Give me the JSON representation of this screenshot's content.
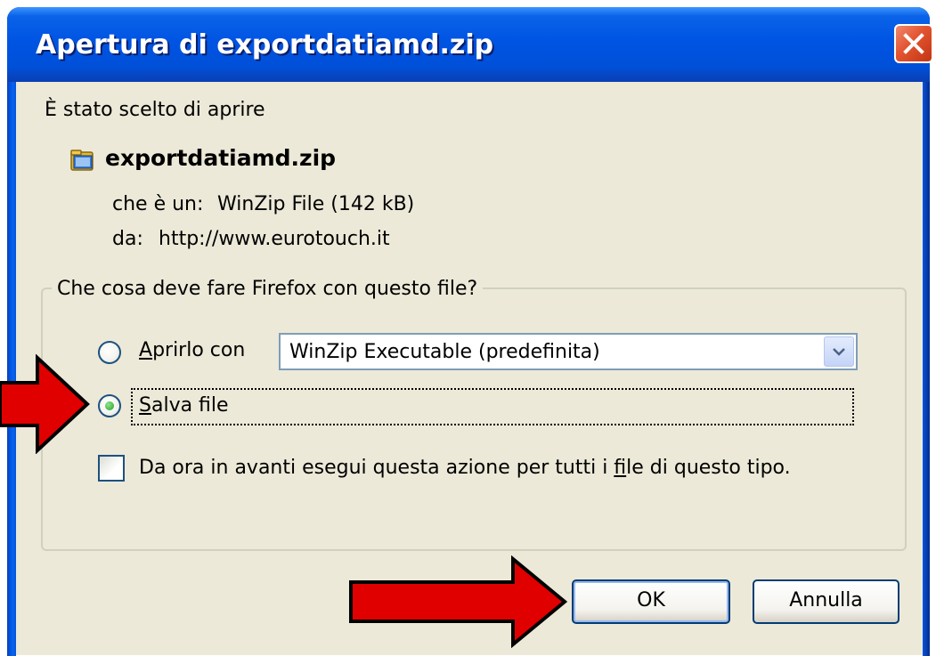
{
  "window": {
    "title": "Apertura di exportdatiamd.zip"
  },
  "intro": {
    "text": "È stato scelto di aprire"
  },
  "file": {
    "name": "exportdatiamd.zip",
    "icon": "zip-folder-icon",
    "type_label": "che è un:",
    "type_value": "WinZip File (142 kB)",
    "from_label": "da:",
    "from_value": "http://www.eurotouch.it"
  },
  "action_group": {
    "legend": "Che cosa deve fare Firefox con questo file?",
    "open_with": {
      "label_accel": "A",
      "label_rest": "prirlo con",
      "selected": false,
      "app_selected": "WinZip Executable (predefinita)"
    },
    "save_file": {
      "label_accel": "S",
      "label_rest": "alva file",
      "selected": true
    },
    "remember": {
      "label_before": "Da ora in avanti esegui questa azione per tutti i ",
      "label_accel": "f",
      "label_after": "ile di questo tipo.",
      "checked": false
    }
  },
  "buttons": {
    "ok_label": "OK",
    "cancel_label": "Annulla"
  },
  "colors": {
    "titlebar": "#0054e3",
    "dialog_bg": "#ece9d8",
    "annotation_arrow": "#e00000"
  }
}
